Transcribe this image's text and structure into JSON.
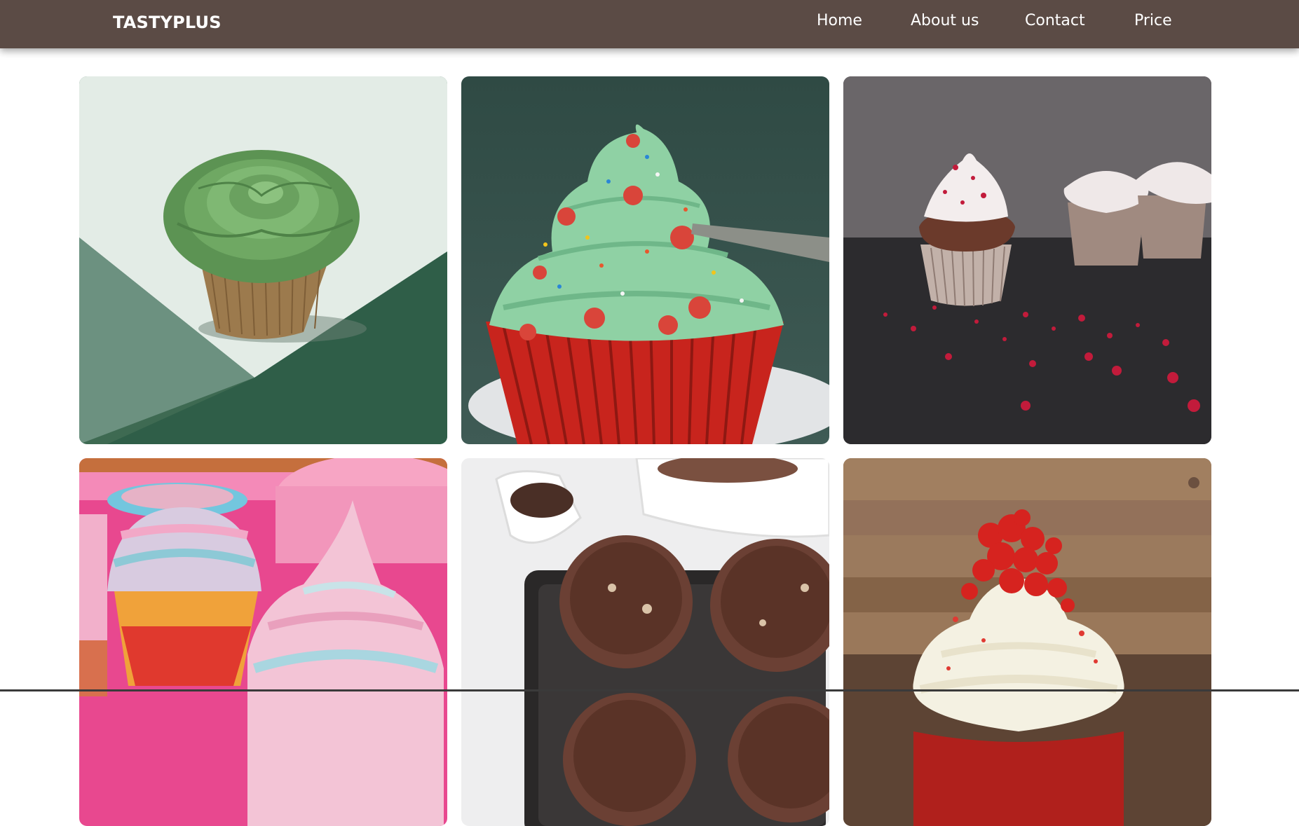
{
  "header": {
    "brand": "TASTYPLUS",
    "nav": [
      {
        "label": "Home"
      },
      {
        "label": "About us"
      },
      {
        "label": "Contact"
      },
      {
        "label": "Price"
      }
    ]
  },
  "gallery": {
    "items": [
      {
        "name": "green-rose-cupcake"
      },
      {
        "name": "green-frosting-sprinkles-cupcake"
      },
      {
        "name": "white-frosting-red-crumb-cupcake"
      },
      {
        "name": "pastel-meringue-cupcakes"
      },
      {
        "name": "chocolate-muffins-tray"
      },
      {
        "name": "red-velvet-cupcake"
      }
    ]
  },
  "colors": {
    "navbar": "#5b4b45",
    "navbar_text": "#ffffff",
    "background": "#ffffff"
  }
}
